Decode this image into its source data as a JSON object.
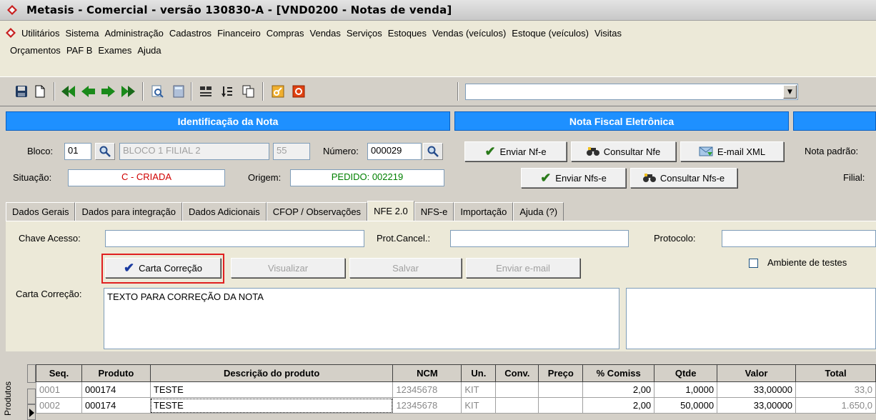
{
  "window": {
    "title": "Metasis - Comercial - versão 130830-A - [VND0200 - Notas de venda]"
  },
  "menu": {
    "row1": [
      "Utilitários",
      "Sistema",
      "Administração",
      "Cadastros",
      "Financeiro",
      "Compras",
      "Vendas",
      "Serviços",
      "Estoques",
      "Vendas (veículos)",
      "Estoque (veículos)",
      "Visitas"
    ],
    "row2": [
      "Orçamentos",
      "PAF B",
      "Exames",
      "Ajuda"
    ]
  },
  "sections": {
    "identificacao": "Identificação da Nota",
    "nfe": "Nota Fiscal Eletrônica"
  },
  "form": {
    "bloco_label": "Bloco:",
    "bloco_value": "01",
    "bloco_desc": "BLOCO 1 FILIAL 2",
    "bloco_code": "55",
    "numero_label": "Número:",
    "numero_value": "000029",
    "situacao_label": "Situação:",
    "situacao_value": "C - CRIADA",
    "origem_label": "Origem:",
    "origem_value": "PEDIDO: 002219",
    "nota_padrao_label": "Nota padrão:",
    "filial_label": "Filial:"
  },
  "nfe_buttons": {
    "enviar_nfe": "Enviar Nf-e",
    "consultar_nfe": "Consultar Nfe",
    "email_xml": "E-mail XML",
    "enviar_nfse": "Enviar Nfs-e",
    "consultar_nfse": "Consultar Nfs-e"
  },
  "tabs": [
    "Dados Gerais",
    "Dados para integração",
    "Dados Adicionais",
    "CFOP / Observações",
    "NFE 2.0",
    "NFS-e",
    "Importação",
    "Ajuda (?)"
  ],
  "active_tab": "NFE 2.0",
  "nfe_panel": {
    "chave_label": "Chave Acesso:",
    "prot_cancel_label": "Prot.Cancel.:",
    "protocolo_label": "Protocolo:",
    "ambiente_label": "Ambiente de testes",
    "carta_correcao_btn": "Carta Correção",
    "visualizar_btn": "Visualizar",
    "salvar_btn": "Salvar",
    "enviar_email_btn": "Enviar e-mail",
    "carta_label": "Carta Correção:",
    "carta_text": "TEXTO PARA CORREÇÃO DA NOTA"
  },
  "grid": {
    "side_label": "Produtos",
    "columns": [
      "Seq.",
      "Produto",
      "Descrição do produto",
      "NCM",
      "Un.",
      "Conv.",
      "Preço",
      "% Comiss",
      "Qtde",
      "Valor",
      "Total"
    ],
    "rows": [
      [
        "0001",
        "000174",
        "TESTE",
        "12345678",
        "KIT",
        "",
        "",
        "2,00",
        "1,0000",
        "33,00000",
        "33,0"
      ],
      [
        "0002",
        "000174",
        "TESTE",
        "12345678",
        "KIT",
        "",
        "",
        "2,00",
        "50,0000",
        "33,00000",
        "1.650,0"
      ]
    ]
  },
  "colors": {
    "header_blue": "#1e90ff",
    "status_red": "#d00000",
    "status_green": "#008000",
    "highlight_red": "#e02020"
  }
}
